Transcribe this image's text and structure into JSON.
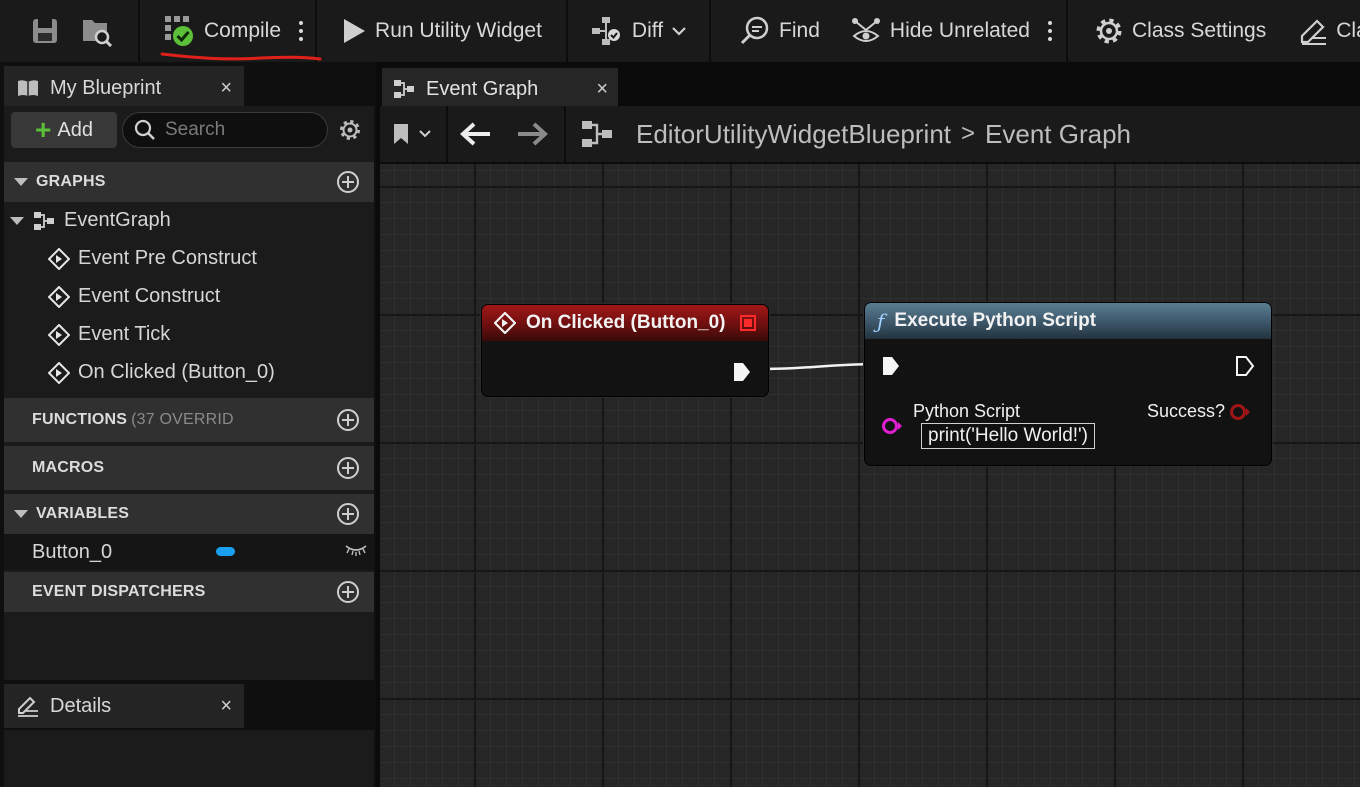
{
  "toolbar": {
    "compile_label": "Compile",
    "run_label": "Run Utility Widget",
    "diff_label": "Diff",
    "find_label": "Find",
    "hide_unrelated_label": "Hide Unrelated",
    "class_settings_label": "Class Settings",
    "class_defaults_label": "Class",
    "icons": [
      "save-icon",
      "browse-icon",
      "compile-success-icon",
      "play-icon",
      "diff-icon",
      "find-icon",
      "hide-unrelated-icon",
      "gear-icon",
      "class-defaults-icon"
    ],
    "annotation_color": "#e0201b"
  },
  "my_blueprint": {
    "tab_label": "My Blueprint",
    "close": "×",
    "add_label": "Add",
    "search_placeholder": "Search",
    "sections": {
      "graphs": "GRAPHS",
      "functions": "FUNCTIONS",
      "functions_note": "(37 OVERRID",
      "macros": "MACROS",
      "variables": "VARIABLES",
      "event_dispatchers": "EVENT DISPATCHERS"
    },
    "event_graph_label": "EventGraph",
    "events": [
      "Event Pre Construct",
      "Event Construct",
      "Event Tick",
      "On Clicked (Button_0)"
    ],
    "variables": [
      {
        "name": "Button_0",
        "type_color": "#1aa0f0"
      }
    ]
  },
  "details": {
    "tab_label": "Details",
    "close": "×"
  },
  "graph": {
    "tab_label": "Event Graph",
    "close": "×",
    "breadcrumb_root": "EditorUtilityWidgetBlueprint",
    "breadcrumb_separator": ">",
    "breadcrumb_current": "Event Graph",
    "nodes": {
      "on_clicked": {
        "title": "On Clicked (Button_0)",
        "color": "#a11818"
      },
      "execute_python": {
        "title": "Execute Python Script",
        "function_glyph": "ƒ",
        "input_label": "Python Script",
        "input_value": "print('Hello World!')",
        "output_label": "Success?",
        "color": "#4d6d82"
      }
    }
  }
}
